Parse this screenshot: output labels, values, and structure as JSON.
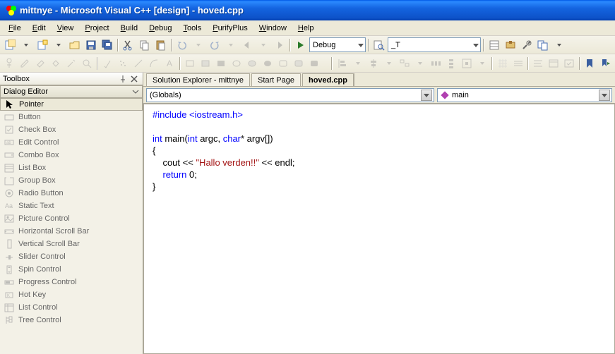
{
  "window": {
    "title": "mittnye - Microsoft Visual C++ [design] - hoved.cpp"
  },
  "menu": {
    "items": [
      {
        "label": "File",
        "u": 0
      },
      {
        "label": "Edit",
        "u": 0
      },
      {
        "label": "View",
        "u": 0
      },
      {
        "label": "Project",
        "u": 0
      },
      {
        "label": "Build",
        "u": 0
      },
      {
        "label": "Debug",
        "u": 0
      },
      {
        "label": "Tools",
        "u": 0
      },
      {
        "label": "PurifyPlus",
        "u": 0
      },
      {
        "label": "Window",
        "u": 0
      },
      {
        "label": "Help",
        "u": 0
      }
    ]
  },
  "toolbar1": {
    "config_label": "Debug",
    "find_value": "_T"
  },
  "toolbox": {
    "title": "Toolbox",
    "group_title": "Dialog Editor",
    "items": [
      {
        "label": "Pointer",
        "active": true,
        "icon": "pointer"
      },
      {
        "label": "Button",
        "active": false,
        "icon": "button"
      },
      {
        "label": "Check Box",
        "active": false,
        "icon": "checkbox"
      },
      {
        "label": "Edit Control",
        "active": false,
        "icon": "edit"
      },
      {
        "label": "Combo Box",
        "active": false,
        "icon": "combo"
      },
      {
        "label": "List Box",
        "active": false,
        "icon": "listbox"
      },
      {
        "label": "Group Box",
        "active": false,
        "icon": "groupbox"
      },
      {
        "label": "Radio Button",
        "active": false,
        "icon": "radio"
      },
      {
        "label": "Static Text",
        "active": false,
        "icon": "static"
      },
      {
        "label": "Picture Control",
        "active": false,
        "icon": "picture"
      },
      {
        "label": "Horizontal Scroll Bar",
        "active": false,
        "icon": "hscroll"
      },
      {
        "label": "Vertical Scroll Bar",
        "active": false,
        "icon": "vscroll"
      },
      {
        "label": "Slider Control",
        "active": false,
        "icon": "slider"
      },
      {
        "label": "Spin Control",
        "active": false,
        "icon": "spin"
      },
      {
        "label": "Progress Control",
        "active": false,
        "icon": "progress"
      },
      {
        "label": "Hot Key",
        "active": false,
        "icon": "hotkey"
      },
      {
        "label": "List Control",
        "active": false,
        "icon": "listctrl"
      },
      {
        "label": "Tree Control",
        "active": false,
        "icon": "treectrl"
      }
    ]
  },
  "tabs": {
    "items": [
      {
        "label": "Solution Explorer - mittnye",
        "active": false
      },
      {
        "label": "Start Page",
        "active": false
      },
      {
        "label": "hoved.cpp",
        "active": true
      }
    ]
  },
  "navbar": {
    "scope": "(Globals)",
    "member": "main",
    "member_icon": "diamond-purple"
  },
  "code": {
    "lines": [
      {
        "t": "pp",
        "s": "#include <iostream.h>"
      },
      {
        "t": "",
        "s": ""
      },
      {
        "t": "mix",
        "parts": [
          {
            "c": "kw",
            "s": "int"
          },
          {
            "c": "",
            "s": " main("
          },
          {
            "c": "kw",
            "s": "int"
          },
          {
            "c": "",
            "s": " argc, "
          },
          {
            "c": "kw",
            "s": "char"
          },
          {
            "c": "",
            "s": "* argv[])"
          }
        ]
      },
      {
        "t": "",
        "s": "{"
      },
      {
        "t": "mix",
        "parts": [
          {
            "c": "",
            "s": "    cout << "
          },
          {
            "c": "str",
            "s": "\"Hallo verden!!\""
          },
          {
            "c": "",
            "s": " << endl;"
          }
        ]
      },
      {
        "t": "mix",
        "parts": [
          {
            "c": "",
            "s": "    "
          },
          {
            "c": "kw",
            "s": "return"
          },
          {
            "c": "",
            "s": " 0;"
          }
        ]
      },
      {
        "t": "",
        "s": "}"
      }
    ]
  }
}
